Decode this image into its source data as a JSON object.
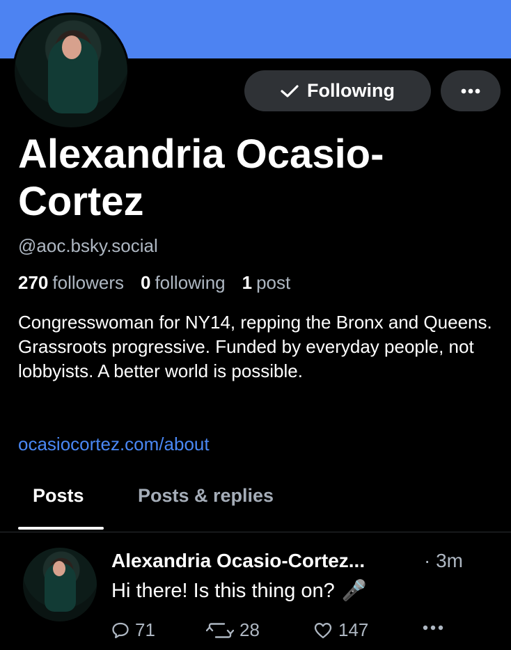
{
  "colors": {
    "banner": "#4d83f2",
    "link": "#4a88f5",
    "button_bg": "#2f3236",
    "muted": "#aeb7c2"
  },
  "profile": {
    "name": "Alexandria Ocasio-Cortez",
    "handle": "@aoc.bsky.social",
    "follow_button_label": "Following",
    "follow_icon": "checkmark-icon",
    "more_icon": "ellipsis-icon",
    "stats": {
      "followers_count": "270",
      "followers_label": "followers",
      "following_count": "0",
      "following_label": "following",
      "posts_count": "1",
      "posts_label": "post"
    },
    "bio": "Congresswoman for NY14, repping the Bronx and Queens. Grassroots progressive. Funded by everyday people, not lobbyists. A better world is possible.",
    "link": "ocasiocortez.com/about"
  },
  "tabs": [
    {
      "label": "Posts",
      "active": true
    },
    {
      "label": "Posts & replies",
      "active": false
    }
  ],
  "post": {
    "author": "Alexandria Ocasio-Cortez...",
    "time": "· 3m",
    "text": "Hi there! Is this thing on?",
    "emoji": "🎤",
    "replies": "71",
    "reposts": "28",
    "likes": "147"
  }
}
